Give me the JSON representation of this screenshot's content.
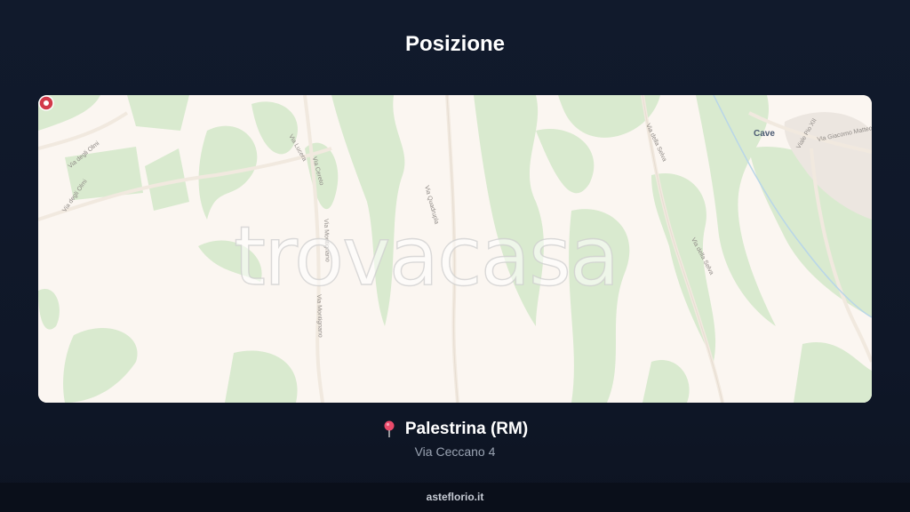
{
  "section_title": "Posizione",
  "map": {
    "watermark": "trovacasa",
    "town_label": "Cave",
    "street_labels": [
      "Via degli Olmi",
      "Via degli Olmi",
      "Via Lucera",
      "Via Cereto",
      "Via Montignano",
      "Via Montignano",
      "Via Quadrupla",
      "Via della Selva",
      "Via della Selva",
      "Viale Pio XII",
      "Via Giacomo Matteotti"
    ]
  },
  "location": {
    "icon": "pin-icon",
    "name": "Palestrina (RM)",
    "address": "Via Ceccano 4"
  },
  "footer": {
    "site": "asteflorio.it"
  },
  "colors": {
    "background": "#111a2c",
    "map_base": "#fbf6f1",
    "map_green": "#d8e9cf",
    "pin": "#d23a4a"
  }
}
